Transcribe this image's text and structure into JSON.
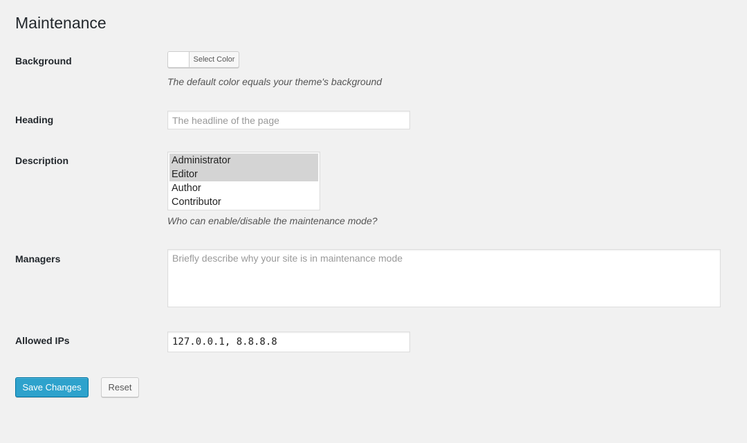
{
  "page": {
    "title": "Maintenance"
  },
  "fields": {
    "background": {
      "label": "Background",
      "button_label": "Select Color",
      "swatch_color": "#ffffff",
      "description": "The default color equals your theme's background"
    },
    "heading": {
      "label": "Heading",
      "value": "",
      "placeholder": "The headline of the page"
    },
    "description": {
      "label": "Description",
      "options": [
        {
          "label": "Administrator",
          "selected": true
        },
        {
          "label": "Editor",
          "selected": true
        },
        {
          "label": "Author",
          "selected": false
        },
        {
          "label": "Contributor",
          "selected": false
        }
      ],
      "help": "Who can enable/disable the maintenance mode?"
    },
    "managers": {
      "label": "Managers",
      "value": "",
      "placeholder": "Briefly describe why your site is in maintenance mode"
    },
    "allowed_ips": {
      "label": "Allowed IPs",
      "value": "127.0.0.1, 8.8.8.8"
    }
  },
  "actions": {
    "save_label": "Save Changes",
    "reset_label": "Reset"
  },
  "colors": {
    "primary": "#2ea2cc",
    "background": "#f1f1f1"
  }
}
